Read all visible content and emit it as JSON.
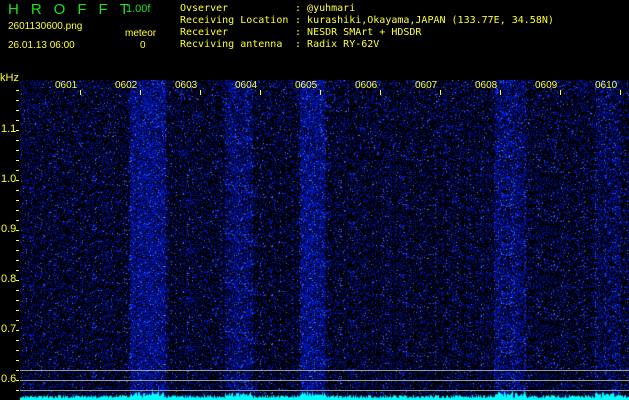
{
  "header": {
    "app_name": "HROFFT",
    "version": "1.00f",
    "filename": "2601130600.png",
    "datetime": "26.01.13 06:00",
    "meteor_label": "meteor",
    "meteor_count": "0"
  },
  "info": [
    {
      "label": "Ovserver",
      "value": "@yuhmari"
    },
    {
      "label": "Receiving Location",
      "value": "kurashiki,Okayama,JAPAN (133.77E, 34.58N)"
    },
    {
      "label": "Receiver",
      "value": "NESDR SMArt + HDSDR"
    },
    {
      "label": "Recviving antenna",
      "value": "Radix RY-62V"
    }
  ],
  "axis": {
    "unit": "kHz",
    "y_labels": [
      "1.1",
      "1.0",
      "0.9",
      "0.8",
      "0.7",
      "0.6"
    ],
    "time_labels": [
      "0601",
      "0602",
      "0603",
      "0604",
      "0605",
      "0606",
      "0607",
      "0608",
      "0609",
      "0610"
    ]
  },
  "colors": {
    "accent_green": "#22dd22",
    "label_yellow": "#ffff33",
    "signal_cyan": "#00ffff",
    "noise_blue": "#2233ff"
  }
}
